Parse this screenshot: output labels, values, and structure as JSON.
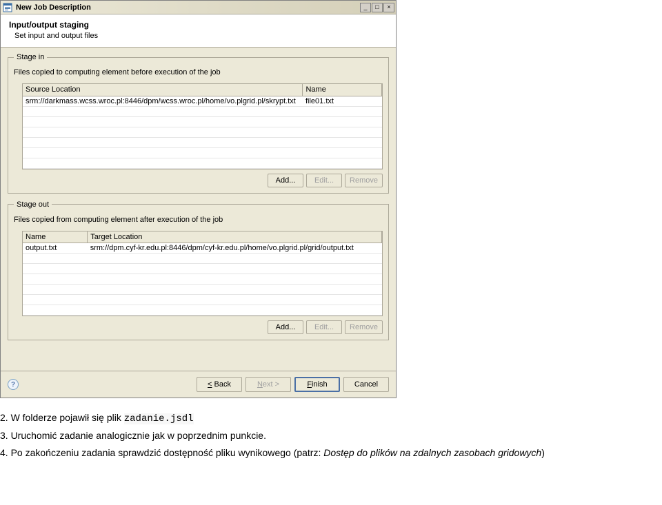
{
  "window": {
    "title": "New Job Description",
    "minimize": "_",
    "maximize": "□",
    "close": "×"
  },
  "header": {
    "title": "Input/output staging",
    "subtitle": "Set input and output files"
  },
  "stage_in": {
    "legend": "Stage in",
    "desc": "Files copied to computing element before execution of the job",
    "columns": {
      "source": "Source Location",
      "name": "Name"
    },
    "rows": [
      {
        "source": "srm://darkmass.wcss.wroc.pl:8446/dpm/wcss.wroc.pl/home/vo.plgrid.pl/skrypt.txt",
        "name": "file01.txt"
      }
    ],
    "buttons": {
      "add": "Add...",
      "edit": "Edit...",
      "remove": "Remove"
    }
  },
  "stage_out": {
    "legend": "Stage out",
    "desc": "Files copied from computing element after execution of the job",
    "columns": {
      "name": "Name",
      "target": "Target Location"
    },
    "rows": [
      {
        "name": "output.txt",
        "target": "srm://dpm.cyf-kr.edu.pl:8446/dpm/cyf-kr.edu.pl/home/vo.plgrid.pl/grid/output.txt"
      }
    ],
    "buttons": {
      "add": "Add...",
      "edit": "Edit...",
      "remove": "Remove"
    }
  },
  "footer": {
    "help": "?",
    "back": "< Back",
    "next": "Next >",
    "finish": "Finish",
    "cancel": "Cancel"
  },
  "instructions": {
    "line2_prefix": "2.  W folderze pojawił się plik ",
    "line2_code": "zadanie.jsdl",
    "line3": "3.  Uruchomić zadanie analogicznie jak w poprzednim punkcie.",
    "line4_a": "4.  Po zakończeniu zadania sprawdzić dostępność pliku wynikowego (patrz: ",
    "line4_italic": "Dostęp do plików na zdalnych zasobach gridowych",
    "line4_b": ")"
  }
}
